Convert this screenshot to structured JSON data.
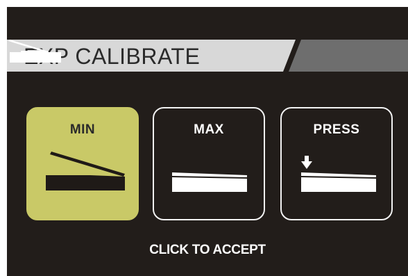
{
  "header": {
    "title": "EXP CALIBRATE",
    "icon": "expression-pedal-icon"
  },
  "steps": [
    {
      "label": "MIN",
      "icon": "pedal-min-icon",
      "selected": true
    },
    {
      "label": "MAX",
      "icon": "pedal-max-icon",
      "selected": false
    },
    {
      "label": "PRESS",
      "icon": "pedal-press-icon",
      "selected": false
    }
  ],
  "footer": {
    "accept_label": "CLICK TO ACCEPT"
  },
  "colors": {
    "background": "#221d1a",
    "header_light": "#d8d8d8",
    "header_dark": "#6e6e6e",
    "selected": "#c9c967",
    "text_light": "#ffffff",
    "text_dark": "#2a2a2a"
  }
}
